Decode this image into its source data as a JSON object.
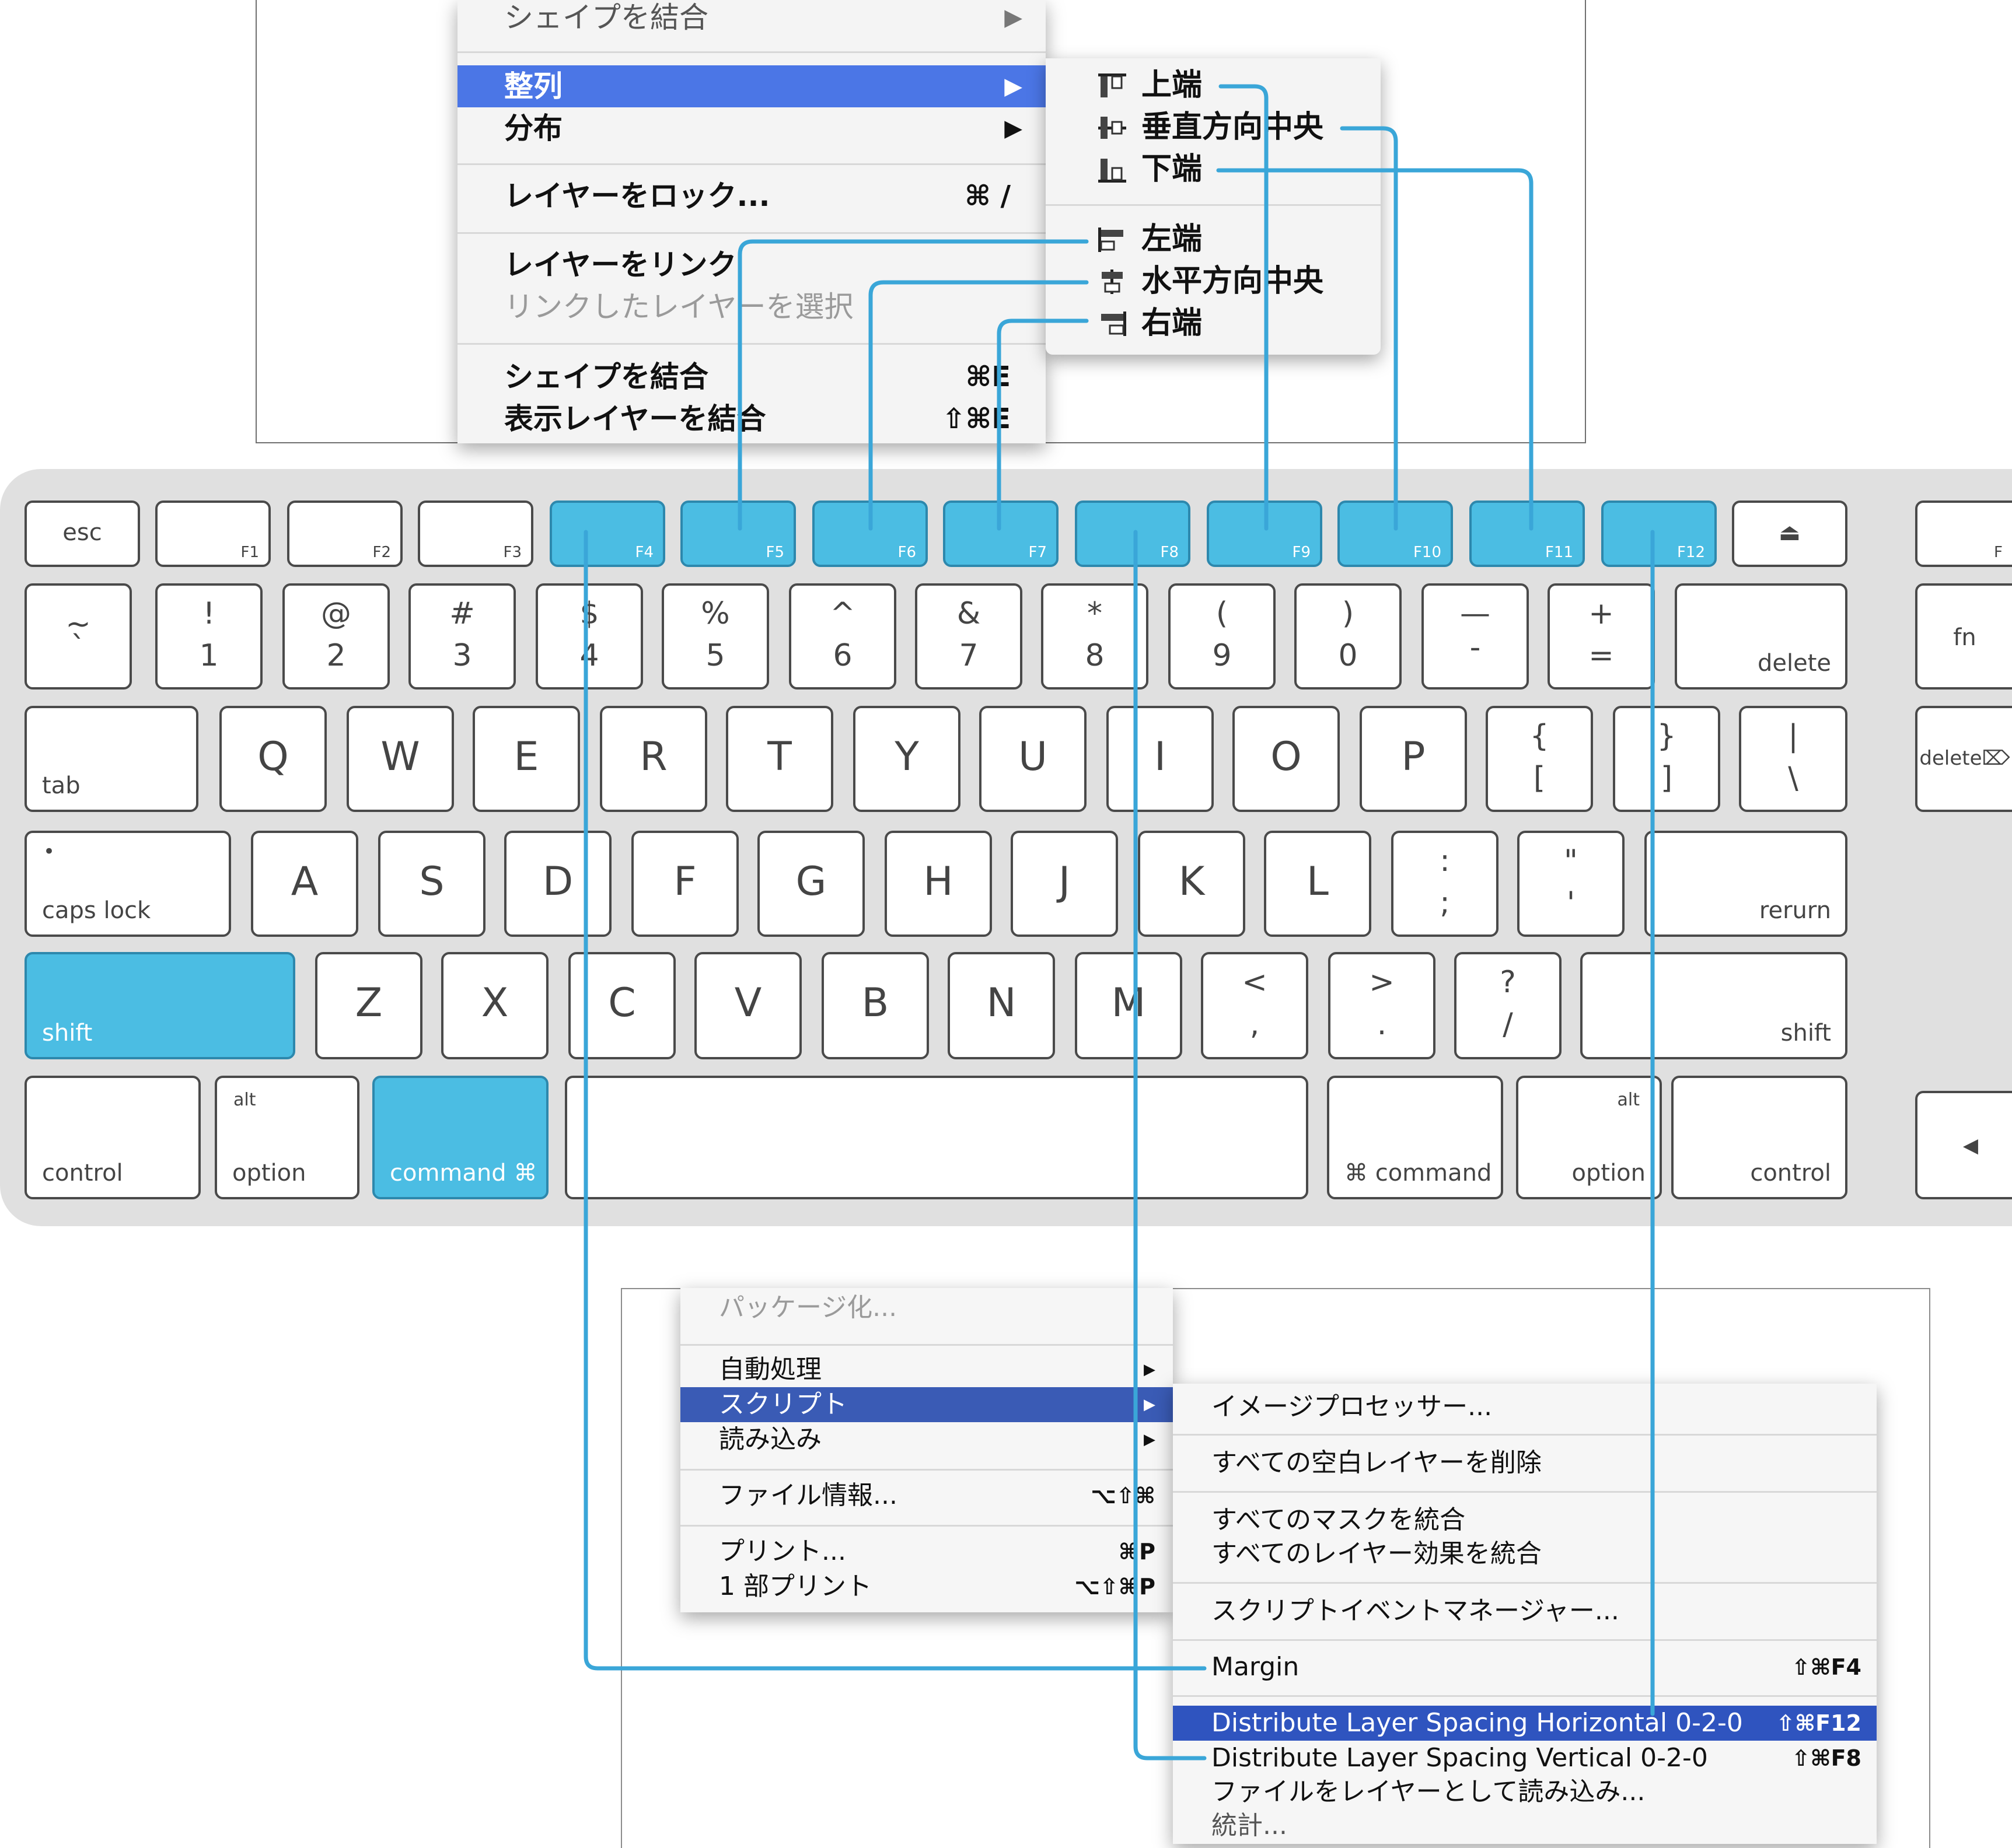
{
  "layer_menu": {
    "items": [
      {
        "label": "シェイプを結合",
        "arrow": "▶"
      },
      {
        "label": "整列",
        "arrow": "▶"
      },
      {
        "label": "分布",
        "arrow": "▶"
      },
      {
        "label": "レイヤーをロック...",
        "shortcut": "⌘ /"
      },
      {
        "label": "レイヤーをリンク"
      },
      {
        "label": "リンクしたレイヤーを選択"
      },
      {
        "label": "シェイプを結合",
        "shortcut": "⌘E"
      },
      {
        "label": "表示レイヤーを結合",
        "shortcut": "⇧⌘E"
      }
    ]
  },
  "align_submenu": {
    "items": [
      {
        "label": "上端",
        "icon": "align-top-icon"
      },
      {
        "label": "垂直方向中央",
        "icon": "align-vcenter-icon"
      },
      {
        "label": "下端",
        "icon": "align-bottom-icon"
      },
      {
        "label": "左端",
        "icon": "align-left-icon"
      },
      {
        "label": "水平方向中央",
        "icon": "align-hcenter-icon"
      },
      {
        "label": "右端",
        "icon": "align-right-icon"
      }
    ]
  },
  "keyboard": {
    "function_row": [
      "esc",
      "F1",
      "F2",
      "F3",
      "F4",
      "F5",
      "F6",
      "F7",
      "F8",
      "F9",
      "F10",
      "F11",
      "F12",
      "⏏",
      "F"
    ],
    "highlighted_keys": [
      "F4",
      "F5",
      "F6",
      "F7",
      "F8",
      "F9",
      "F10",
      "F11",
      "F12",
      "shift",
      "command ⌘"
    ],
    "number_row": [
      {
        "top": "~",
        "bottom": "`"
      },
      {
        "top": "!",
        "bottom": "1"
      },
      {
        "top": "@",
        "bottom": "2"
      },
      {
        "top": "#",
        "bottom": "3"
      },
      {
        "top": "$",
        "bottom": "4"
      },
      {
        "top": "%",
        "bottom": "5"
      },
      {
        "top": "^",
        "bottom": "6"
      },
      {
        "top": "&",
        "bottom": "7"
      },
      {
        "top": "*",
        "bottom": "8"
      },
      {
        "top": "(",
        "bottom": "9"
      },
      {
        "top": ")",
        "bottom": "0"
      },
      {
        "top": "—",
        "bottom": "-"
      },
      {
        "top": "+",
        "bottom": "="
      }
    ],
    "delete": "delete",
    "fn": "fn",
    "delete_fwd": "delete⌦",
    "tab": "tab",
    "qwerty": [
      "Q",
      "W",
      "E",
      "R",
      "T",
      "Y",
      "U",
      "I",
      "O",
      "P"
    ],
    "brackets": [
      {
        "top": "{",
        "bottom": "["
      },
      {
        "top": "}",
        "bottom": "]"
      },
      {
        "top": "|",
        "bottom": "\\"
      }
    ],
    "caps_lock": "caps lock",
    "caps_dot": "•",
    "asdf": [
      "A",
      "S",
      "D",
      "F",
      "G",
      "H",
      "J",
      "K",
      "L"
    ],
    "semicolon": {
      "top": ":",
      "bottom": ";"
    },
    "quote": {
      "top": "\"",
      "bottom": "'"
    },
    "return": "rerurn",
    "shift_left": "shift",
    "zxcv": [
      "Z",
      "X",
      "C",
      "V",
      "B",
      "N",
      "M"
    ],
    "comma": {
      "top": "<",
      "bottom": ","
    },
    "period": {
      "top": ">",
      "bottom": "."
    },
    "slash": {
      "top": "?",
      "bottom": "/"
    },
    "shift_right": "shift",
    "control_left": "control",
    "option_left": "option",
    "alt": "alt",
    "command_left": "command ⌘",
    "command_right": "⌘ command",
    "option_right": "option",
    "control_right": "control",
    "arrow_left": "◀"
  },
  "file_menu": {
    "items": [
      {
        "label": "パッケージ化..."
      },
      {
        "label": "自動処理",
        "arrow": "▶"
      },
      {
        "label": "スクリプト",
        "arrow": "▶"
      },
      {
        "label": "読み込み",
        "arrow": "▶"
      },
      {
        "label": "ファイル情報...",
        "shortcut": "⌥⇧⌘"
      },
      {
        "label": "プリント...",
        "shortcut": "⌘P"
      },
      {
        "label": "1 部プリント",
        "shortcut": "⌥⇧⌘P"
      }
    ]
  },
  "script_submenu": {
    "items": [
      {
        "label": "イメージプロセッサー..."
      },
      {
        "label": "すべての空白レイヤーを削除"
      },
      {
        "label": "すべてのマスクを統合"
      },
      {
        "label": "すべてのレイヤー効果を統合"
      },
      {
        "label": "スクリプトイベントマネージャー..."
      },
      {
        "label": "Margin",
        "shortcut": "⇧⌘F4"
      },
      {
        "label": "Distribute Layer Spacing Horizontal 0-2-0",
        "shortcut": "⇧⌘F12"
      },
      {
        "label": "Distribute Layer Spacing Vertical 0-2-0",
        "shortcut": "⇧⌘F8"
      },
      {
        "label": "ファイルをレイヤーとして読み込み..."
      },
      {
        "label": "統計..."
      }
    ]
  },
  "colors": {
    "highlight_key": "#4bbde3",
    "connector": "#3aa6d8",
    "menu_selected": "#4b76e6",
    "script_selected": "#2f54bf"
  }
}
